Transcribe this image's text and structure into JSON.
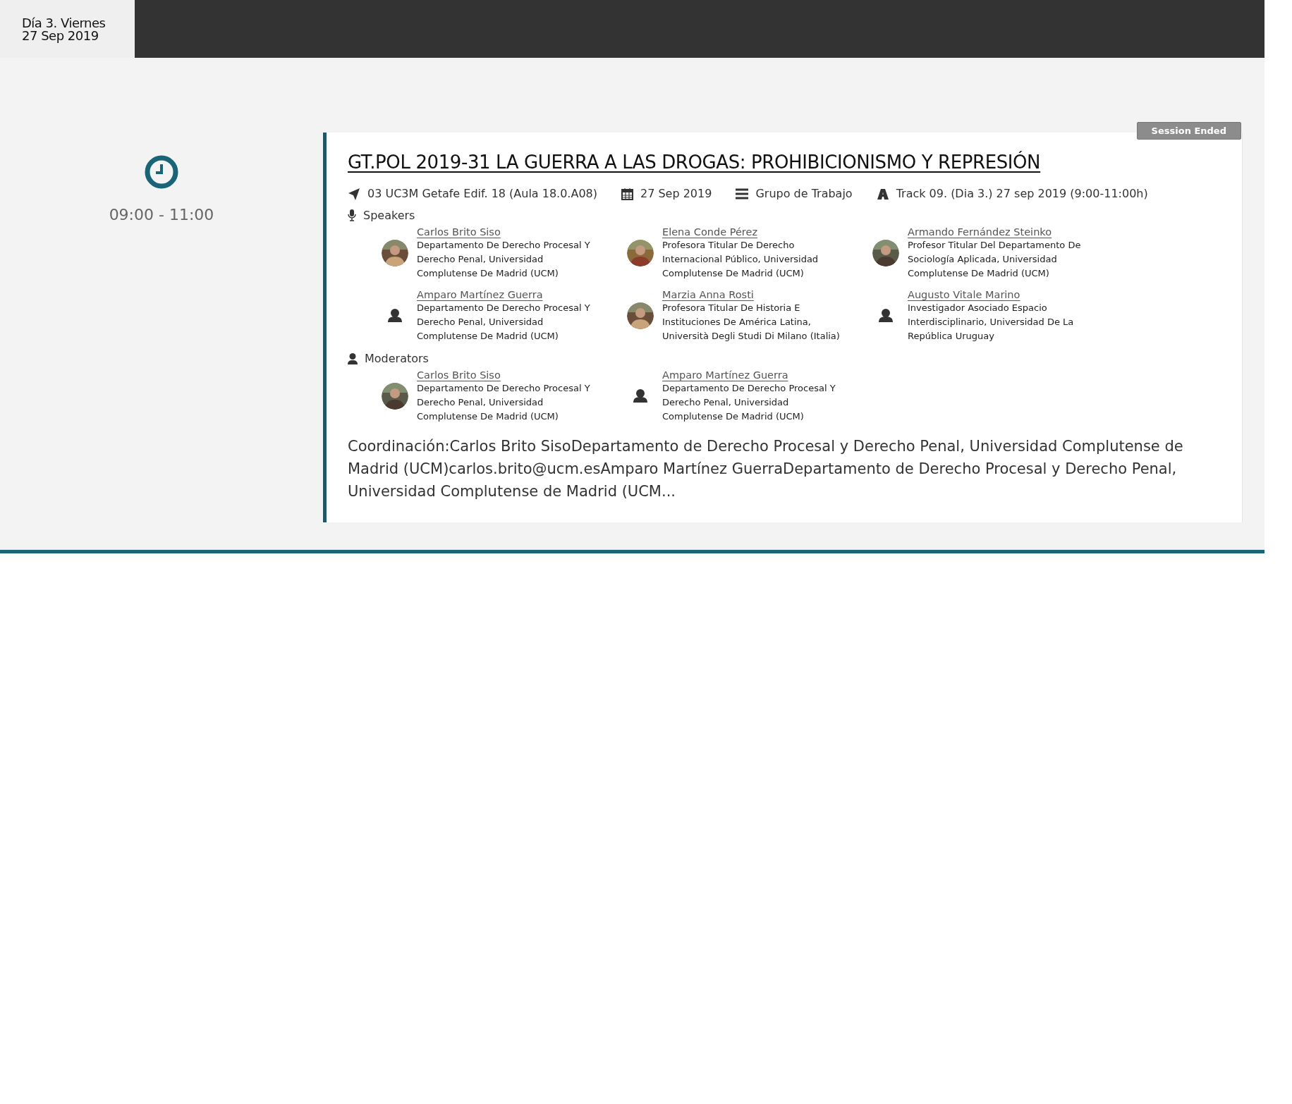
{
  "day_tab": {
    "line_1": "Día 3. Viernes",
    "line_2": "27 Sep 2019"
  },
  "time": "09:00 - 11:00",
  "session": {
    "status": "Session Ended",
    "title": "GT.POL 2019-31 LA GUERRA A LAS DROGAS: PROHIBICIONISMO Y REPRESIÓN",
    "meta": [
      {
        "kind": "location",
        "text": "03 UC3M Getafe Edif. 18 (Aula 18.0.A08)"
      },
      {
        "kind": "date",
        "text": "27 Sep 2019"
      },
      {
        "kind": "type",
        "text": "Grupo de Trabajo"
      },
      {
        "kind": "track",
        "text": "Track 09. (Dia 3.) 27 sep 2019 (9:00-11:00h)"
      }
    ],
    "groups": [
      {
        "kind": "speakers",
        "label": "Speakers",
        "people": [
          {
            "kind": "picture",
            "name": "Carlos Brito Siso",
            "affiliation": "Departamento De Derecho Procesal Y Derecho Penal, Universidad Complutense De Madrid (UCM)"
          },
          {
            "kind": "picture",
            "name": "Elena Conde Pérez",
            "affiliation": "Profesora Titular De Derecho Internacional Público, Universidad Complutense De Madrid (UCM)"
          },
          {
            "kind": "picture",
            "name": "Armando Fernández Steinko",
            "affiliation": "Profesor Titular Del Departamento De Sociología Aplicada, Universidad Complutense De Madrid (UCM)"
          },
          {
            "kind": "placeholder",
            "name": "Amparo Martínez Guerra",
            "affiliation": "Departamento De Derecho Procesal Y Derecho Penal, Universidad Complutense De Madrid (UCM)"
          },
          {
            "kind": "picture",
            "name": "Marzia Anna Rosti",
            "affiliation": "Profesora Titular De Historia E Instituciones De América Latina, Università Degli Studi Di Milano (Italia)"
          },
          {
            "kind": "placeholder",
            "name": "Augusto Vitale Marino",
            "affiliation": "Investigador Asociado Espacio Interdisciplinario, Universidad De La República Uruguay"
          }
        ]
      },
      {
        "kind": "moderators",
        "label": "Moderators",
        "people": [
          {
            "kind": "picture",
            "name": "Carlos Brito Siso",
            "affiliation": "Departamento De Derecho Procesal Y Derecho Penal, Universidad Complutense De Madrid (UCM)"
          },
          {
            "kind": "placeholder",
            "name": "Amparo Martínez Guerra",
            "affiliation": "Departamento De Derecho Procesal Y Derecho Penal, Universidad Complutense De Madrid (UCM)"
          }
        ]
      }
    ],
    "description": "Coordinación:Carlos Brito SisoDepartamento de Derecho Procesal y Derecho Penal, Universidad Complutense de Madrid (UCM)carlos.brito@ucm.esAmparo Martínez GuerraDepartamento de Derecho Procesal y Derecho Penal, Universidad Complutense de Madrid (UCM..."
  }
}
